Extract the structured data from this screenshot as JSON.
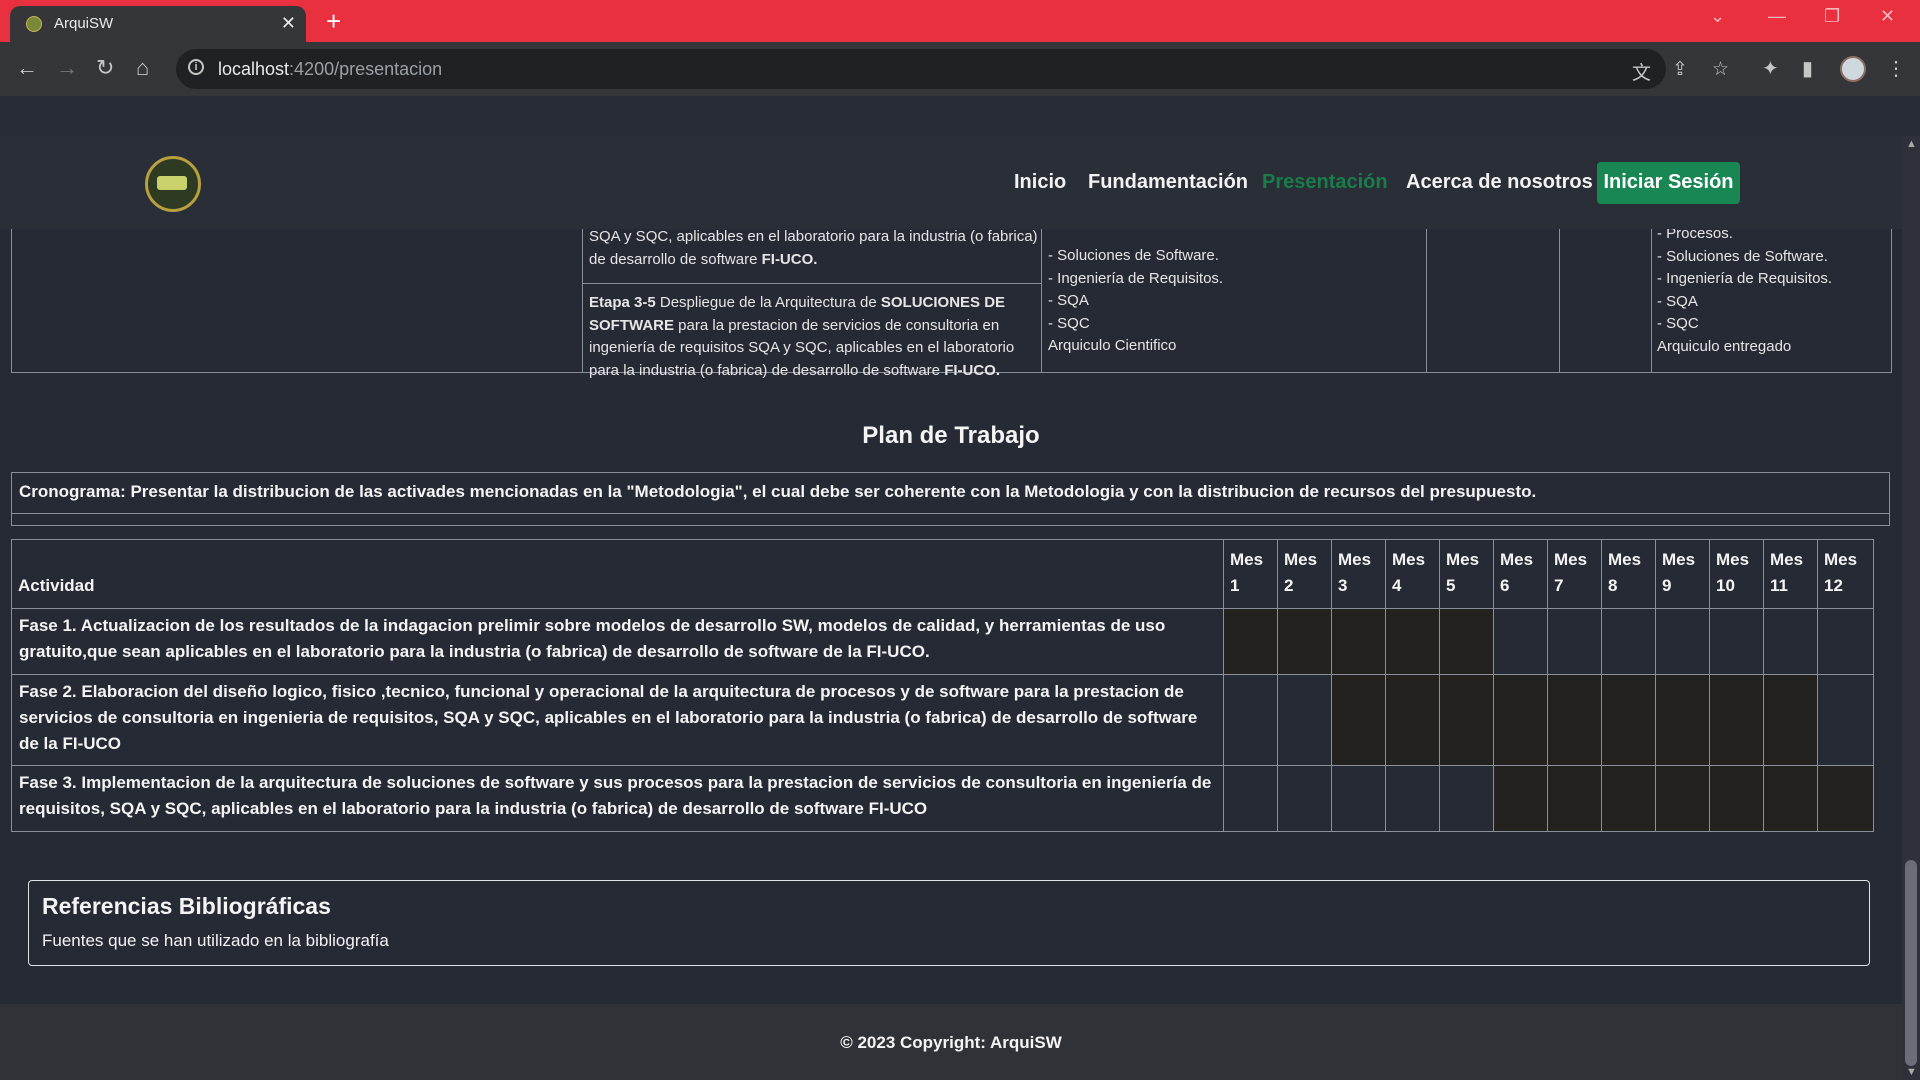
{
  "browser": {
    "tab_title": "ArquiSW",
    "tab_close": "✕",
    "new_tab": "+",
    "url_host": "localhost",
    "url_path": ":4200/presentacion"
  },
  "navbar": {
    "links": [
      "Inicio",
      "Fundamentación",
      "Presentación",
      "Acerca de nosotros"
    ],
    "active": "Presentación",
    "login_label": "Iniciar Sesión",
    "active_color": "#1b7c4b",
    "button_color": "#198754"
  },
  "top_table": {
    "cell1_line1": "SQA y SQC, aplicables en el laboratorio para la industria (o fabrica)",
    "cell1_line2_pre": "de desarrollo de software ",
    "cell1_line2_bold": "FI-UCO.",
    "etapa_label": "Etapa 3-5",
    "etapa_text_1": " Despliegue de la Arquitectura de ",
    "etapa_bold_1": "SOLUCIONES DE",
    "etapa_bold_2": "SOFTWARE",
    "etapa_text_2": " para la prestacion de servicios de consultoria en",
    "etapa_line3": "ingeniería de requisitos SQA y SQC, aplicables en el laboratorio",
    "etapa_line4_pre": "para la industria (o fabrica) de desarrollo de software ",
    "etapa_line4_bold": "FI-UCO.",
    "products_mid": [
      "- Soluciones de Software.",
      "- Ingeniería de Requisitos.",
      "- SQA",
      "- SQC",
      "Arquiculo Cientifico"
    ],
    "products_right": [
      "- Procesos.",
      "- Soluciones de Software.",
      "- Ingeniería de Requisitos.",
      "- SQA",
      "- SQC",
      "Arquiculo entregado"
    ]
  },
  "plan": {
    "title": "Plan de Trabajo",
    "cronograma": "Cronograma: Presentar la distribucion de las activades mencionadas en la \"Metodologia\", el cual debe ser coherente con la Metodologia y con la distribucion de recursos del presupuesto.",
    "header_activity": "Actividad",
    "months": [
      "Mes 1",
      "Mes 2",
      "Mes 3",
      "Mes 4",
      "Mes 5",
      "Mes 6",
      "Mes 7",
      "Mes 8",
      "Mes 9",
      "Mes 10",
      "Mes 11",
      "Mes 12"
    ],
    "rows": [
      {
        "text": "Fase 1. Actualizacion de los resultados de la indagacion prelimir sobre modelos de desarrollo SW, modelos de calidad, y herramientas de uso gratuito,que sean aplicables en el laboratorio para la industria (o fabrica) de desarrollo de software de la FI-UCO.",
        "filled_months": [
          1,
          2,
          3,
          4,
          5
        ]
      },
      {
        "text": "Fase 2. Elaboracion del diseño logico, fisico ,tecnico, funcional y operacional de la arquitectura de procesos y de software para la prestacion de servicios de consultoria en ingenieria de requisitos, SQA y SQC, aplicables en el laboratorio para la industria (o fabrica) de desarrollo de software de la FI-UCO",
        "filled_months": [
          3,
          4,
          5,
          6,
          7,
          8,
          9,
          10,
          11
        ]
      },
      {
        "text": "Fase 3. Implementacion de la arquitectura de soluciones de software y sus procesos para la prestacion de servicios de consultoria en ingeniería de requisitos, SQA y SQC, aplicables en el laboratorio para la industria (o fabrica) de desarrollo de software FI-UCO",
        "filled_months": [
          6,
          7,
          8,
          9,
          10,
          11,
          12
        ]
      }
    ],
    "filled_color": "#23221e"
  },
  "references": {
    "title": "Referencias Bibliográficas",
    "subtitle": "Fuentes que se han utilizado en la bibliografía"
  },
  "footer": {
    "text": "© 2023 Copyright: ArquiSW"
  }
}
